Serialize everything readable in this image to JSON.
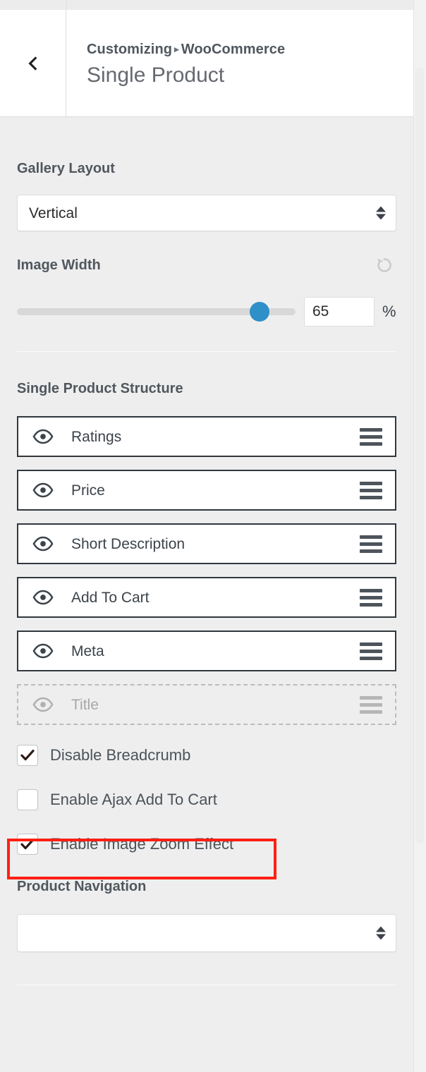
{
  "header": {
    "back_icon": "chevron-left-icon",
    "breadcrumb_prefix": "Customizing",
    "breadcrumb_separator": "▸",
    "breadcrumb_section": "WooCommerce",
    "title": "Single Product"
  },
  "gallery_layout": {
    "label": "Gallery Layout",
    "selected": "Vertical",
    "options": [
      "Vertical"
    ]
  },
  "image_width": {
    "label": "Image Width",
    "reset_icon": "reset-icon",
    "value": "65",
    "unit": "%",
    "slider_percent": 87,
    "min": 0,
    "max": 100
  },
  "single_product_structure": {
    "label": "Single Product Structure",
    "rows": [
      {
        "label": "Ratings",
        "visible": true,
        "eye_icon": "eye-icon",
        "drag_icon": "drag-handle-icon"
      },
      {
        "label": "Price",
        "visible": true,
        "eye_icon": "eye-icon",
        "drag_icon": "drag-handle-icon"
      },
      {
        "label": "Short Description",
        "visible": true,
        "eye_icon": "eye-icon",
        "drag_icon": "drag-handle-icon"
      },
      {
        "label": "Add To Cart",
        "visible": true,
        "eye_icon": "eye-icon",
        "drag_icon": "drag-handle-icon"
      },
      {
        "label": "Meta",
        "visible": true,
        "eye_icon": "eye-icon",
        "drag_icon": "drag-handle-icon"
      },
      {
        "label": "Title",
        "visible": false,
        "eye_icon": "eye-icon",
        "drag_icon": "drag-handle-icon"
      }
    ]
  },
  "checkboxes": [
    {
      "label": "Disable Breadcrumb",
      "checked": true
    },
    {
      "label": "Enable Ajax Add To Cart",
      "checked": false,
      "highlighted": true
    },
    {
      "label": "Enable Image Zoom Effect",
      "checked": true
    }
  ],
  "product_navigation": {
    "label": "Product Navigation",
    "selected": "",
    "options": []
  },
  "colors": {
    "panel_background": "#eeeeee",
    "header_background": "#ffffff",
    "slider_accent": "#2e8fc9",
    "row_border": "#32373c",
    "highlight": "#ff2014",
    "label_text": "#50575e"
  }
}
